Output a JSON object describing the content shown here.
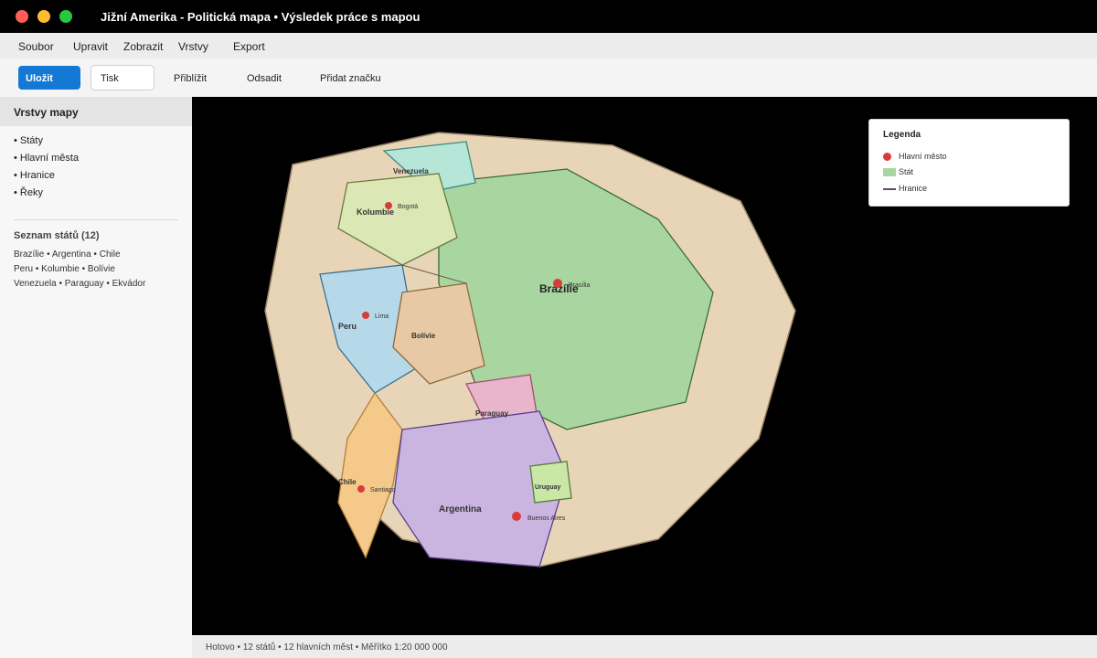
{
  "window": {
    "title": "Jižní Amerika - Politická mapa • Výsledek práce s mapou"
  },
  "menu": [
    "Soubor",
    "Upravit",
    "Zobrazit",
    "Vrstvy",
    "Export"
  ],
  "toolbar": {
    "save": "Uložit",
    "print": "Tisk",
    "zoom_in": "Přiblížit",
    "zoom_out": "Odsadit",
    "add_marker": "Přidat značku"
  },
  "sidebar": {
    "header": "Vrstvy mapy",
    "layers": [
      "• Státy",
      "• Hlavní města",
      "• Hranice",
      "• Řeky"
    ],
    "countries_title": "Seznam států (12)",
    "countries_lines": [
      "Brazílie • Argentina • Chile",
      "Peru • Kolumbie • Bolívie",
      "Venezuela • Paraguay • Ekvádor"
    ]
  },
  "map": {
    "colors": {
      "continent": "#e8d5b7",
      "brazil": "#a9d6a0",
      "venezuela": "#b5e6d8",
      "colombia": "#dbe8b5",
      "peru": "#b5d9e8",
      "bolivia": "#e8c9a6",
      "paraguay": "#e8b5cc",
      "argentina": "#c9b5e0",
      "chile": "#f5c98a",
      "uruguay": "#c9e8a6",
      "capital": "#d93b3b"
    },
    "countries": {
      "venezuela": "Venezuela",
      "colombia": "Kolumbie",
      "brazil": "Brazílie",
      "peru": "Peru",
      "bolivia": "Bolívie",
      "paraguay": "Paraguay",
      "chile": "Chile",
      "argentina": "Argentina",
      "uruguay": "Uruguay"
    },
    "capitals": {
      "bogota": "Bogotá",
      "brasilia": "Brasília",
      "lima": "Lima",
      "santiago": "Santiago",
      "buenos_aires": "Buenos Aires"
    }
  },
  "legend": {
    "title": "Legenda",
    "capital": "Hlavní město",
    "state": "Stát",
    "border": "Hranice"
  },
  "status": "Hotovo • 12 států • 12 hlavních měst • Měřítko 1:20 000 000"
}
